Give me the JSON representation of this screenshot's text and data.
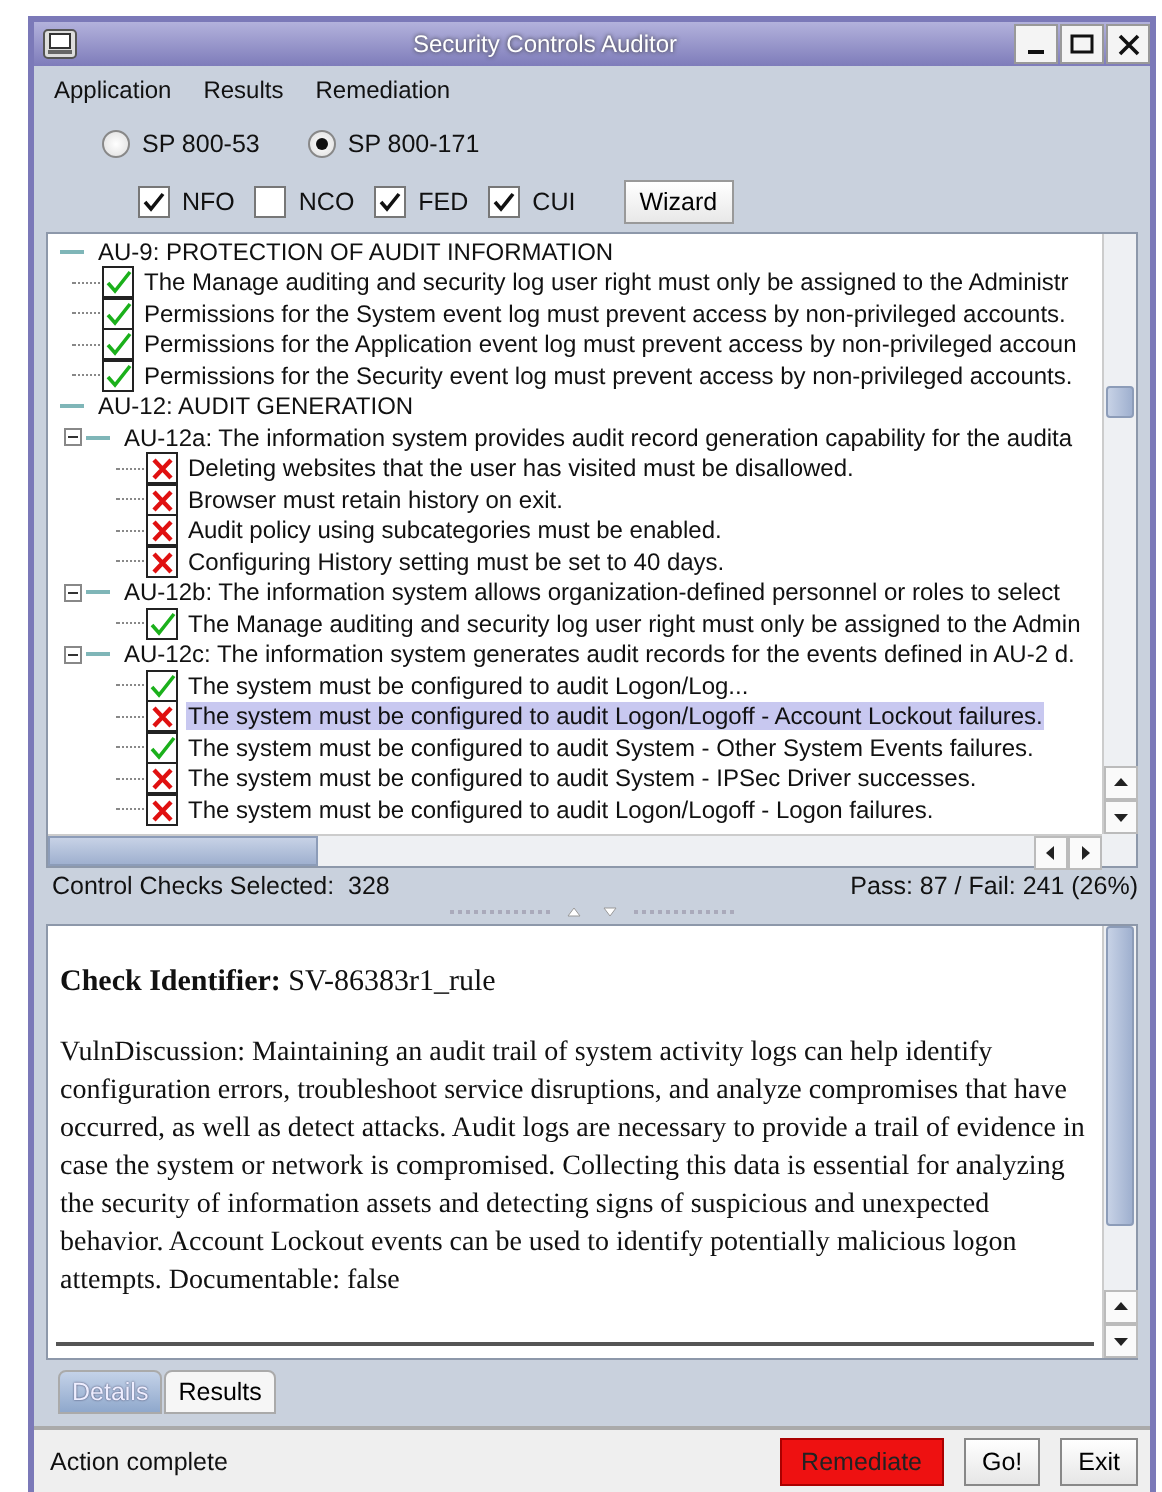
{
  "window": {
    "title": "Security Controls Auditor"
  },
  "menu": [
    "Application",
    "Results",
    "Remediation"
  ],
  "standards": [
    {
      "label": "SP 800-53",
      "selected": false
    },
    {
      "label": "SP 800-171",
      "selected": true
    }
  ],
  "filters": [
    {
      "label": "NFO",
      "checked": true
    },
    {
      "label": "NCO",
      "checked": false
    },
    {
      "label": "FED",
      "checked": true
    },
    {
      "label": "CUI",
      "checked": true
    }
  ],
  "wizard_button": "Wizard",
  "tree": [
    {
      "label": "AU-9: PROTECTION OF AUDIT INFORMATION",
      "children": [
        {
          "label": "The Manage auditing and security log user right must only be assigned to the Administr",
          "passed": true,
          "selected": false
        },
        {
          "label": "Permissions for the System event log must prevent access by non-privileged accounts.",
          "passed": true,
          "selected": false
        },
        {
          "label": "Permissions for the Application event log must prevent access by non-privileged accoun",
          "passed": true,
          "selected": false
        },
        {
          "label": "Permissions for the Security event log must prevent access by non-privileged accounts.",
          "passed": true,
          "selected": false
        }
      ]
    },
    {
      "label": "AU-12: AUDIT GENERATION",
      "children": [
        {
          "label": "AU-12a: The information system provides audit record generation capability for the audita",
          "expanded": true,
          "children": [
            {
              "label": "Deleting websites that the user has visited must be disallowed.",
              "passed": false,
              "selected": false
            },
            {
              "label": "Browser must retain history on exit.",
              "passed": false,
              "selected": false
            },
            {
              "label": "Audit policy using subcategories must be enabled.",
              "passed": false,
              "selected": false
            },
            {
              "label": "Configuring History setting must be set to 40 days.",
              "passed": false,
              "selected": false
            }
          ]
        },
        {
          "label": "AU-12b: The information system allows organization-defined personnel or roles to select",
          "expanded": true,
          "children": [
            {
              "label": "The Manage auditing and security log user right must only be assigned to the Admin",
              "passed": true,
              "selected": false
            }
          ]
        },
        {
          "label": "AU-12c: The information system generates audit records for the events defined in AU-2 d.",
          "expanded": true,
          "children": [
            {
              "label": "The system must be configured to audit Logon/Log...",
              "passed": true,
              "selected": false
            },
            {
              "label": "The system must be configured to audit Logon/Logoff - Account Lockout failures.",
              "passed": false,
              "selected": true
            },
            {
              "label": "The system must be configured to audit System - Other System Events failures.",
              "passed": true,
              "selected": false
            },
            {
              "label": "The system must be configured to audit System - IPSec Driver successes.",
              "passed": false,
              "selected": false
            },
            {
              "label": "The system must be configured to audit Logon/Logoff - Logon failures.",
              "passed": false,
              "selected": false
            }
          ]
        }
      ]
    }
  ],
  "summary": {
    "label": "Control Checks Selected:",
    "count": "328",
    "pass_fail": "Pass: 87 / Fail: 241 (26%)"
  },
  "details": {
    "identifier": "**Check Identifier:** SV-86383r1_rule",
    "discussion": "VulnDiscussion: Maintaining an audit trail of system activity logs can help identify configuration errors, troubleshoot service disruptions, and analyze compromises that have occurred, as well as detect attacks. Audit logs are necessary to provide a trail of evidence in case the system or network is compromised. Collecting this data is essential for analyzing the security of information assets and detecting signs of suspicious and unexpected behavior. Account Lockout events can be used to identify potentially malicious logon attempts. Documentable: false"
  },
  "tabs": [
    {
      "label": "Details",
      "selected": true
    },
    {
      "label": "Results",
      "selected": false
    }
  ],
  "status": "Action complete",
  "buttons": [
    {
      "label": "Remediate",
      "kind": "danger"
    },
    {
      "label": "Go!",
      "kind": "normal"
    },
    {
      "label": "Exit",
      "kind": "normal"
    }
  ]
}
